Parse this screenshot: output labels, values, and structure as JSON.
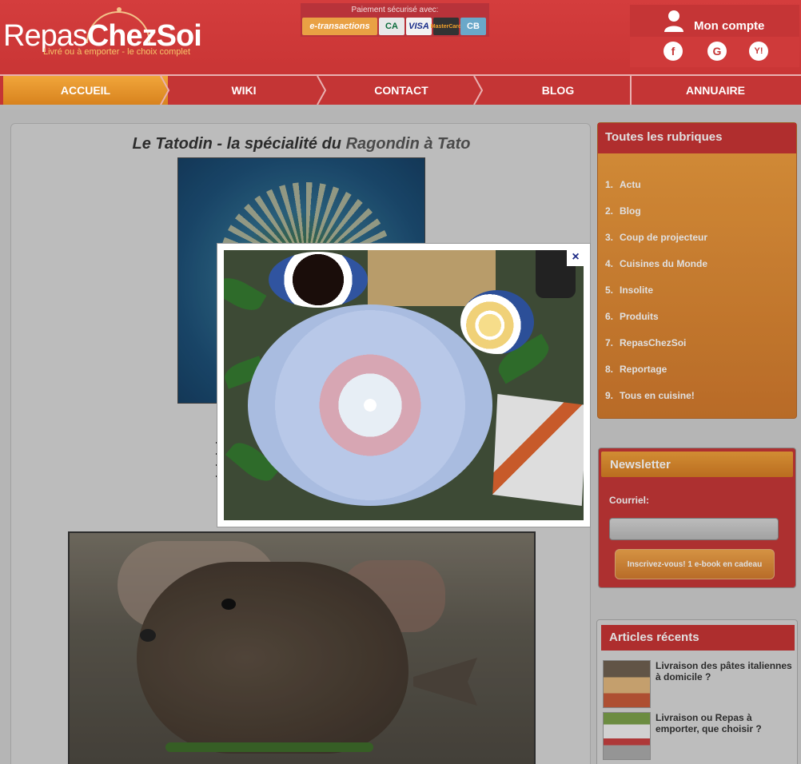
{
  "header": {
    "logo_part1": "Repas",
    "logo_part2": "ChezSoi",
    "logo_tagline": "Livré ou à emporter - le choix complet",
    "payment_label": "Paiement sécurisé avec:",
    "payment_cards": [
      "e-transactions",
      "CA",
      "VISA",
      "MasterCard",
      "CB"
    ],
    "account_label": "Mon compte",
    "social": [
      {
        "name": "facebook-icon",
        "glyph": "f"
      },
      {
        "name": "google-icon",
        "glyph": "G"
      },
      {
        "name": "yahoo-icon",
        "glyph": "Y!"
      }
    ]
  },
  "nav": {
    "items": [
      "ACCUEIL",
      "WIKI",
      "CONTACT",
      "BLOG",
      "ANNUAIRE"
    ],
    "active": "ACCUEIL"
  },
  "article": {
    "title_part1": "Le Tatodin",
    "title_part2": " - la spécialité du ",
    "title_part3": "Ragondin à Tato"
  },
  "sidebar": {
    "rubriques_title": "Toutes les rubriques",
    "rubriques": [
      {
        "num": "1.",
        "label": "Actu"
      },
      {
        "num": "2.",
        "label": "Blog"
      },
      {
        "num": "3.",
        "label": "Coup de projecteur"
      },
      {
        "num": "4.",
        "label": "Cuisines du Monde"
      },
      {
        "num": "5.",
        "label": "Insolite"
      },
      {
        "num": "6.",
        "label": "Produits"
      },
      {
        "num": "7.",
        "label": "RepasChezSoi"
      },
      {
        "num": "8.",
        "label": "Reportage"
      },
      {
        "num": "9.",
        "label": "Tous en cuisine!"
      }
    ],
    "newsletter_title": "Newsletter",
    "newsletter_label": "Courriel:",
    "newsletter_input_value": "",
    "newsletter_button": "Inscrivez-vous! 1 e-book en cadeau",
    "recent_title": "Articles récents",
    "recent_articles": [
      "Livraison des pâtes italiennes à domicile ?",
      "Livraison ou Repas à emporter, que choisir ?"
    ]
  },
  "modal": {
    "close_label": "×"
  },
  "colors": {
    "brand_red": "#c93535",
    "brand_orange": "#f0a040",
    "close_blue": "#1f2d87"
  }
}
